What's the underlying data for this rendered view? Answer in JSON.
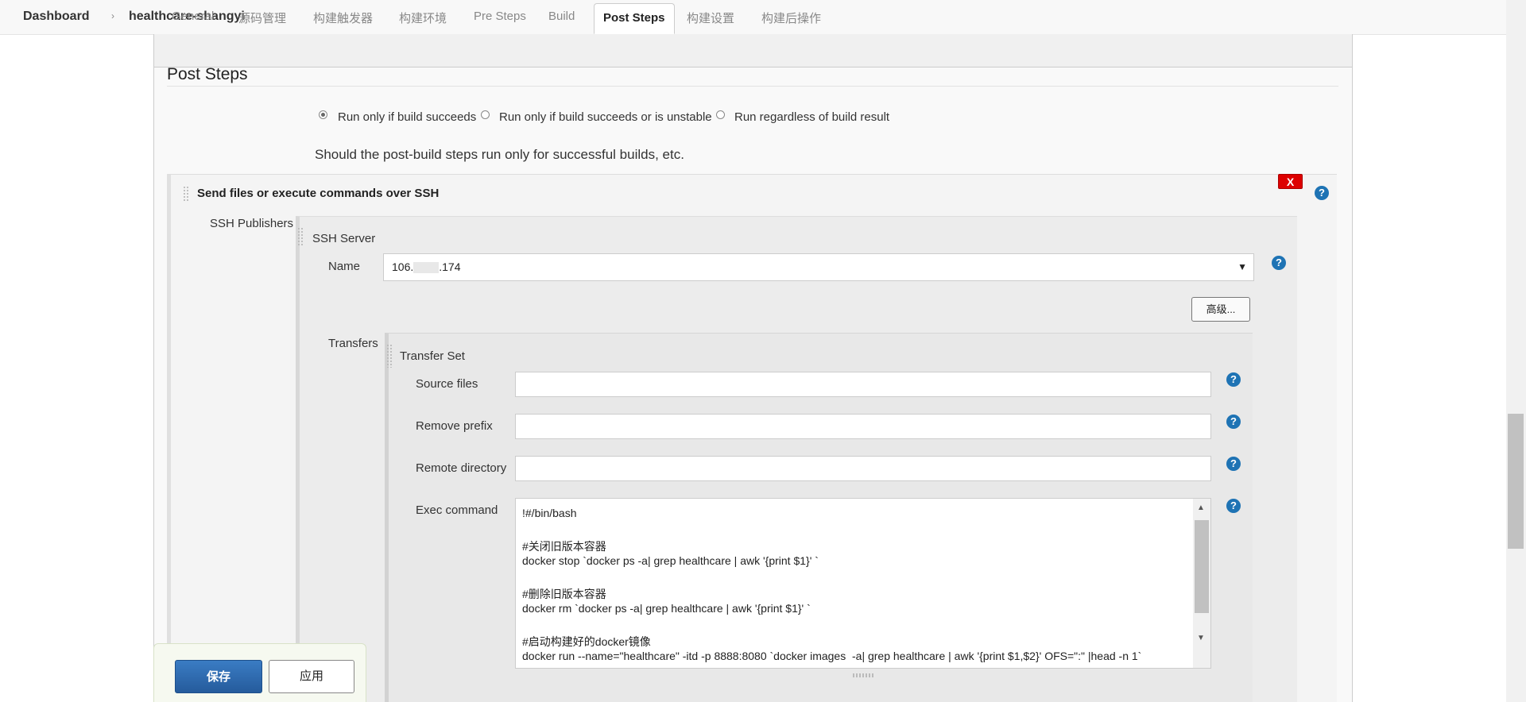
{
  "breadcrumb": {
    "items": [
      "Dashboard",
      "healthcare-shangyi"
    ],
    "separator": "›"
  },
  "tabs": [
    "General",
    "源码管理",
    "构建触发器",
    "构建环境",
    "Pre Steps",
    "Build",
    "Post Steps",
    "构建设置",
    "构建后操作"
  ],
  "active_tab": "Post Steps",
  "section": {
    "title": "Post Steps",
    "radio_options": [
      "Run only if build succeeds",
      "Run only if build succeeds or is unstable",
      "Run regardless of build result"
    ],
    "selected_option": "Run only if build succeeds",
    "description": "Should the post-build steps run only for successful builds, etc."
  },
  "publisher": {
    "title": "Send files or execute commands over SSH",
    "delete_label": "X",
    "help_label": "?",
    "ssh_publishers_label": "SSH Publishers",
    "ssh_server_label": "SSH Server",
    "name_label": "Name",
    "name_value_prefix": "106.",
    "name_value_suffix": ".174",
    "advanced_button": "高级...",
    "transfers_label": "Transfers",
    "transfer_set_label": "Transfer Set",
    "source_files_label": "Source files",
    "source_files_value": "",
    "remove_prefix_label": "Remove prefix",
    "remove_prefix_value": "",
    "remote_directory_label": "Remote directory",
    "remote_directory_value": "",
    "exec_command_label": "Exec command",
    "exec_command_lines": [
      "!#/bin/bash",
      "",
      "#关闭旧版本容器",
      "docker stop `docker ps -a| grep healthcare | awk '{print $1}' `",
      "",
      "#删除旧版本容器",
      "docker rm `docker ps -a| grep healthcare | awk '{print $1}' `",
      "",
      "#启动构建好的docker镜像",
      "docker run --name=\"healthcare\" -itd -p 8888:8080 `docker images  -a| grep healthcare | awk '{print $1,$2}' OFS=\":\" |head -n 1`"
    ]
  },
  "buttons": {
    "save": "保存",
    "apply": "应用"
  },
  "colors": {
    "delete": "#dd0000",
    "help": "#1e73b4",
    "save": "#2b6cb0"
  }
}
